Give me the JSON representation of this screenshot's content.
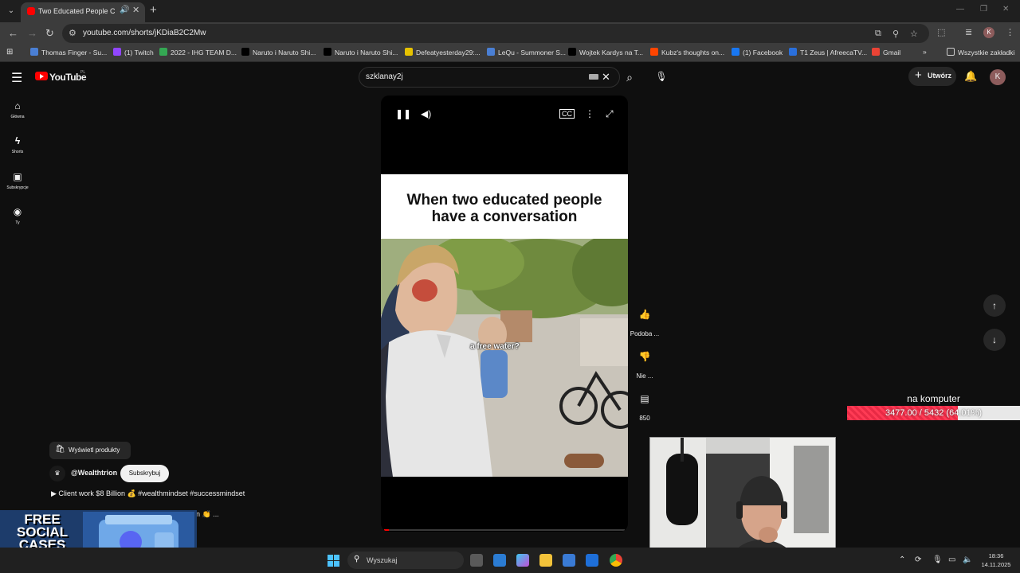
{
  "browser": {
    "active_tab_title": "Two Educated People Conv",
    "url": "youtube.com/shorts/jKDiaB2C2Mw",
    "bookmarks": [
      {
        "label": "Thomas Finger - Su...",
        "color": "#4a7fd4"
      },
      {
        "label": "(1) Twitch",
        "color": "#9146ff"
      },
      {
        "label": "2022 - IHG TEAM D...",
        "color": "#34a853"
      },
      {
        "label": "Naruto i Naruto Shi...",
        "color": "#000000"
      },
      {
        "label": "Naruto i Naruto Shi...",
        "color": "#000000"
      },
      {
        "label": "Defeatyesterday29:...",
        "color": "#e6c200"
      },
      {
        "label": "LeQu - Summoner S...",
        "color": "#4a7fd4"
      },
      {
        "label": "Wojtek Kardys na T...",
        "color": "#000000"
      },
      {
        "label": "Kubz's thoughts on...",
        "color": "#ff4500"
      },
      {
        "label": "(1) Facebook",
        "color": "#1877f2"
      },
      {
        "label": "T1 Zeus | AfreecaTV...",
        "color": "#2a6fdb"
      },
      {
        "label": "Gmail",
        "color": "#ea4335"
      }
    ],
    "all_bookmarks": "Wszystkie zakładki",
    "profile_initial": "K"
  },
  "youtube": {
    "logo_text": "YouTube",
    "region": "PL",
    "search_query": "szklanay2j",
    "create_label": "Utwórz",
    "avatar_initial": "K",
    "guide": [
      {
        "label": "Główna",
        "icon": "home-icon"
      },
      {
        "label": "Shorts",
        "icon": "shorts-icon"
      },
      {
        "label": "Subskrypcje",
        "icon": "subscriptions-icon"
      },
      {
        "label": "Ty",
        "icon": "you-icon"
      }
    ]
  },
  "short": {
    "card_line1": "When two educated people",
    "card_line2": "have a conversation",
    "caption": "a free water?",
    "progress": 0.02,
    "actions": {
      "like": "Podoba ...",
      "dislike": "Nie ...",
      "comments": "850"
    },
    "products_label": "Wyświetl produkty",
    "channel": "@Wealthtrion",
    "subscribe": "Subskrybuj",
    "description": "Client work $8 Billion 💰 #wealthmindset #successmindset",
    "description_tail": "n 👏 ..."
  },
  "stream_overlay": {
    "goal_title": "na komputer",
    "goal_text": "3477.00 / 5432 (64.01%)",
    "goal_fraction": 0.6401,
    "promo_text": "FREE SOCIAL CASES"
  },
  "taskbar": {
    "search_label": "Wyszukaj",
    "time": "18:36",
    "date": "14.11.2025"
  }
}
